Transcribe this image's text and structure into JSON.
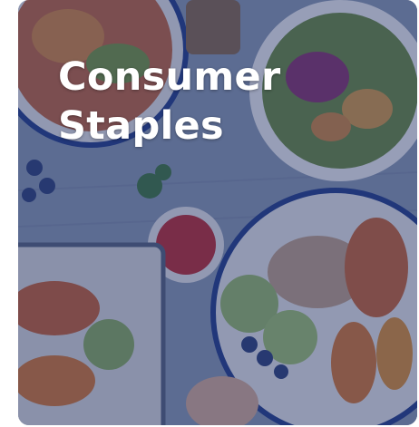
{
  "card": {
    "title_line_1": "Consumer",
    "title_line_2": "Staples",
    "overlay_color": "#263468"
  }
}
